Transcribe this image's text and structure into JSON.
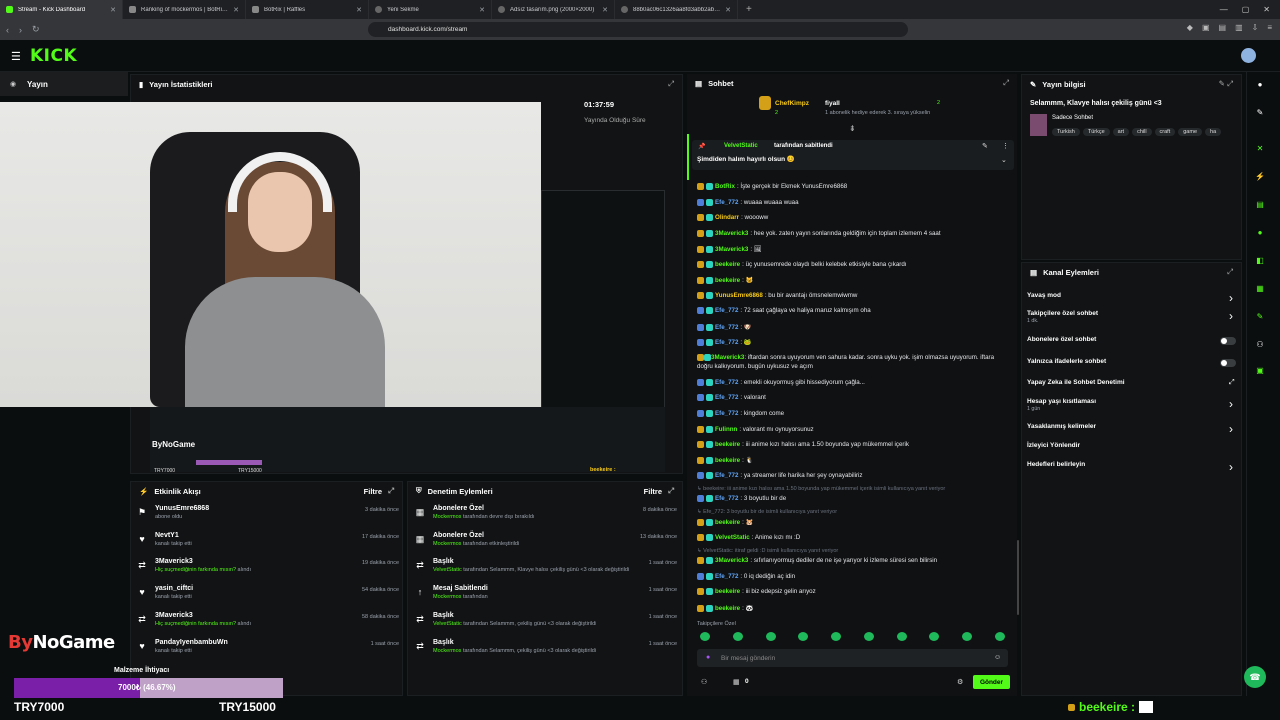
{
  "tabs": [
    {
      "label": "Stream - Kick Dashboard",
      "active": true
    },
    {
      "label": "Ranking of mockermos | BotRix — D"
    },
    {
      "label": "BotRix | Raffles"
    },
    {
      "label": "Yeni Sekme"
    },
    {
      "label": "Adsız tasarım.png (2000×2000)"
    },
    {
      "label": "88b0ac06c1326aa8fd3abb2abf6dcc..."
    }
  ],
  "url": "dashboard.kick.com/stream",
  "brand": {
    "logo": "KICK",
    "accent": "#53fc18"
  },
  "nav": {
    "section": "Yayın"
  },
  "stats": {
    "title": "Yayın İstatistikleri",
    "timer": "01:37:59",
    "timer_label": "Yayında Olduğu Süre"
  },
  "stream_screen": {
    "logo": "ByNoGame",
    "goal_label": "Malzeme İhtiyacı",
    "min": "TRY7000",
    "max": "TRY15000",
    "user": "beekeire :"
  },
  "activity": {
    "title": "Etkinlik Akışı",
    "filter": "Filtre",
    "rows": [
      {
        "icon": "user-plus-icon",
        "name": "YunusEmre6868",
        "sub": "abone oldu",
        "time": "3 dakika önce"
      },
      {
        "icon": "heart-icon",
        "name": "NevtY1",
        "sub": "kanalı takip etti",
        "time": "17 dakika önce"
      },
      {
        "icon": "share-icon",
        "name": "3Maverick3",
        "sub_hl": "Hiç suçmediğinin farkında mısın?",
        "sub": " alındı",
        "time": "19 dakika önce"
      },
      {
        "icon": "heart-icon",
        "name": "yasin_ciftci",
        "sub": "kanalı takip etti",
        "time": "54 dakika önce"
      },
      {
        "icon": "share-icon",
        "name": "3Maverick3",
        "sub_hl": "Hiç suçmediğinin farkında mısın?",
        "sub": " alındı",
        "time": "58 dakika önce"
      },
      {
        "icon": "heart-icon",
        "name": "PandayIyenbambuWn",
        "sub": "kanalı takip etti",
        "time": "1 saat önce"
      }
    ]
  },
  "moderation": {
    "title": "Denetim Eylemleri",
    "filter": "Filtre",
    "rows": [
      {
        "name": "Abonelere Özel",
        "sub_hl": "Mockermos",
        "sub": " tarafından devre dışı bırakıldı",
        "time": "8 dakika önce"
      },
      {
        "name": "Abonelere Özel",
        "sub_hl": "Mockermos",
        "sub": " tarafından etkinleştirildi",
        "time": "13 dakika önce"
      },
      {
        "name": "Başlık",
        "sub_hl": "VelvetStatic",
        "sub": " tarafından Selammm, Klavye halısı çekiliş günü <3 olarak değiştirildi",
        "time": "1 saat önce"
      },
      {
        "name": "Mesaj Sabitlendi",
        "sub_hl": "Mockermos",
        "sub": " tarafından",
        "time": "1 saat önce"
      },
      {
        "name": "Başlık",
        "sub_hl": "VelvetStatic",
        "sub": " tarafından Selammm, çekiliş günü <3 olarak değiştirildi",
        "time": "1 saat önce"
      },
      {
        "name": "Başlık",
        "sub_hl": "Mockermos",
        "sub": " tarafından Selammm, çekiliş günü <3 olarak değiştirildi",
        "time": "1 saat önce"
      }
    ]
  },
  "chat": {
    "title": "Sohbet",
    "top_gifter": "ChefKimpz",
    "top_gifter_count": "2",
    "second": "fiyall",
    "second_count": "2",
    "gift_note": "1 abonelik hediye ederek 3. sıraya yükselin",
    "pinned_by": "VelvetStatic",
    "pinned_suffix": " tarafından sabitlendi",
    "pinned_msg": "Şimdiden halım hayırlı olsun 😊",
    "messages": [
      {
        "user": "BotRix",
        "color": "#53fc18",
        "text": ": İşte gerçek bir Ekmek YunusEmre6868"
      },
      {
        "user": "Efe_772",
        "color": "#60a5fa",
        "text": ": wuaaa wuaaa wuaa"
      },
      {
        "user": "Olindarr",
        "color": "#facc15",
        "text": ": woooww"
      },
      {
        "user": "3Maverick3",
        "color": "#53fc18",
        "text": ": hee yok. zaten yayın sonlarında geldiğim için toplam izlemem 4 saat"
      },
      {
        "user": "3Maverick3",
        "color": "#53fc18",
        "text": ": 🖼"
      },
      {
        "user": "beekeire",
        "color": "#53fc18",
        "text": ": üç yunusemrede olaydı belki kelebek etkisiyle bana çıkardı"
      },
      {
        "user": "beekeire",
        "color": "#53fc18",
        "text": ": 🐱"
      },
      {
        "user": "YunusEmre6868",
        "color": "#facc15",
        "text": ": bu bir avantajı ömsnelemwiwmw"
      },
      {
        "user": "Efe_772",
        "color": "#60a5fa",
        "text": ": 72 saat çağlaya ve haliya maruz kalmışım oha"
      },
      {
        "user": "Efe_772",
        "color": "#60a5fa",
        "text": ": 🐶"
      },
      {
        "user": "Efe_772",
        "color": "#60a5fa",
        "text": ": 🐸"
      },
      {
        "user": "3Maverick3",
        "color": "#53fc18",
        "text": ": iftardan sonra uyuyorum ven sahura kadar. sonra uyku yok. işim olmazsa uyuyorum. iftara doğru kalkıyorum. bugün uykusuz ve açım"
      },
      {
        "user": "Efe_772",
        "color": "#60a5fa",
        "text": ": emekli okuyormuş gibi hissediyorum çağla..."
      },
      {
        "user": "Efe_772",
        "color": "#60a5fa",
        "text": ": valorant"
      },
      {
        "user": "Efe_772",
        "color": "#60a5fa",
        "text": ": kingdom come"
      },
      {
        "user": "Fulinnn",
        "color": "#53fc18",
        "text": ": valorant mı oynuyorsunuz"
      },
      {
        "user": "beekeire",
        "color": "#53fc18",
        "text": ": iii anime kızı halısı ama 1.50 boyunda yap mükemmel içerik"
      },
      {
        "user": "beekeire",
        "color": "#53fc18",
        "text": ": 🐧"
      },
      {
        "user": "Efe_772",
        "color": "#60a5fa",
        "text": ": ya streamer life harika her şey oynayabiliriz"
      },
      {
        "user": "",
        "color": "#6b7280",
        "text": "↳ beekeire: iii anime kızı halısı ama 1.50 boyunda yap mükemmel içerik isimli kullanıcıya yanıt veriyor",
        "sys": true
      },
      {
        "user": "Efe_772",
        "color": "#60a5fa",
        "text": ": 3 boyutlu bir de"
      },
      {
        "user": "",
        "color": "#6b7280",
        "text": "↳ Efe_772: 3 boyutlu bir de isimli kullanıcıya yanıt veriyor",
        "sys": true
      },
      {
        "user": "beekeire",
        "color": "#53fc18",
        "text": ": 🐹"
      },
      {
        "user": "VelvetStatic",
        "color": "#53fc18",
        "text": ": Anime kızı mı :D"
      },
      {
        "user": "",
        "color": "#6b7280",
        "text": "↳ VelvetStatic: itiraf geldi :D isimli kullanıcıya yanıt veriyor",
        "sys": true
      },
      {
        "user": "3Maverick3",
        "color": "#53fc18",
        "text": ": sıfırlanıyormuş dediler de ne işe yarıyor ki izleme süresi sen bilirsin"
      },
      {
        "user": "Efe_772",
        "color": "#60a5fa",
        "text": ": 0 iq dediğin aç idin"
      },
      {
        "user": "beekeire",
        "color": "#53fc18",
        "text": ": iii biz edepsiz gelin arıyoz"
      },
      {
        "user": "beekeire",
        "color": "#53fc18",
        "text": ": 🐼"
      }
    ],
    "followers_only": "Takipçilere Özel",
    "input_placeholder": "Bir mesaj gönderin",
    "send": "Gönder",
    "count": "0"
  },
  "stream_info": {
    "title": "Yayın bilgisi",
    "stream_title": "Selammm, Klavye halısı çekiliş günü <3",
    "category": "Sadece Sohbet",
    "tags": [
      "Turkish",
      "Türkçe",
      "art",
      "chill",
      "craft",
      "game",
      "ha"
    ]
  },
  "channel_actions": {
    "title": "Kanal Eylemleri",
    "items": [
      {
        "label": "Yavaş mod",
        "type": "chevron"
      },
      {
        "label": "Takipçilere özel sohbet",
        "sub": "1 dk.",
        "type": "chevron"
      },
      {
        "label": "Abonelere özel sohbet",
        "type": "toggle"
      },
      {
        "label": "Yalnızca ifadelerle sohbet",
        "type": "toggle"
      },
      {
        "label": "Yapay Zeka ile Sohbet Denetimi",
        "type": "link"
      },
      {
        "label": "Hesap yaşı kısıtlaması",
        "sub": "1 gün",
        "type": "chevron"
      },
      {
        "label": "Yasaklanmış kelimeler",
        "type": "chevron"
      },
      {
        "label": "İzleyici Yönlendir",
        "type": "none"
      },
      {
        "label": "Hedefleri belirleyin",
        "type": "chevron"
      }
    ]
  },
  "overlay": {
    "logo_a": "By",
    "logo_b": "NoGame",
    "goal_label": "Malzeme İhtiyacı",
    "goal_text": "7000₺ (46.67%)",
    "goal_progress": 0.4667,
    "min": "TRY7000",
    "max": "TRY15000",
    "viewer": "beekeire :"
  }
}
